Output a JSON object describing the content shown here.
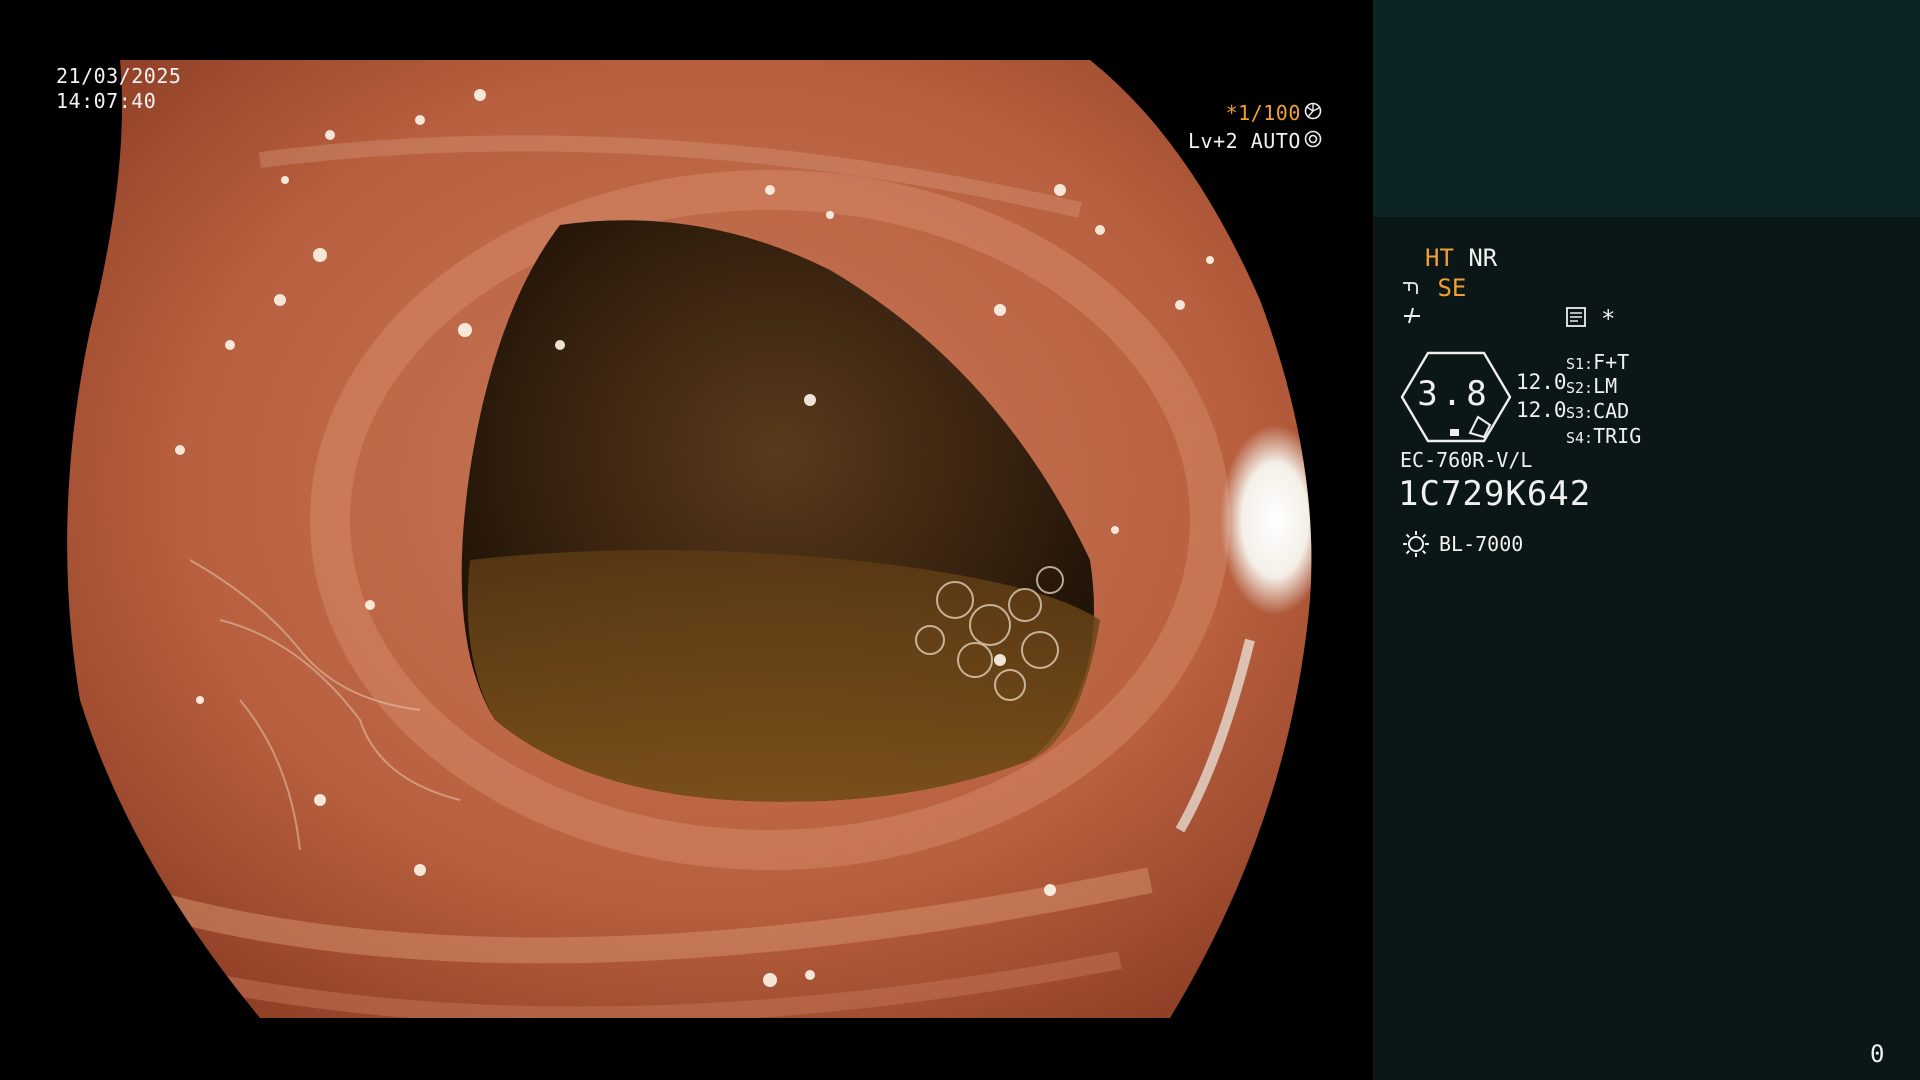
{
  "overlay": {
    "date": "21/03/2025",
    "time": "14:07:40",
    "shutter": "*1/100",
    "shutter_icon": "aperture-icon",
    "exposure_level": "Lv+2 AUTO",
    "exposure_icon": "iris-icon"
  },
  "side_panel": {
    "ht_label": "HT",
    "nr_label": "NR",
    "se_label": "SE",
    "zoom_value": "3.8",
    "value_a": "12.0",
    "value_b": "12.0",
    "switches": [
      {
        "key": "S1:",
        "value": "F+T"
      },
      {
        "key": "S2:",
        "value": "LM"
      },
      {
        "key": "S3:",
        "value": "CAD"
      },
      {
        "key": "S4:",
        "value": "TRIG"
      }
    ],
    "asterisk": "*",
    "scope_model": "EC-760R-V/L",
    "serial_number": "1C729K642",
    "light_source": "BL-7000",
    "counter": "0",
    "colors": {
      "panel_bg": "#0b1717",
      "panel_top": "#0d2424",
      "accent": "#f0a030"
    }
  }
}
